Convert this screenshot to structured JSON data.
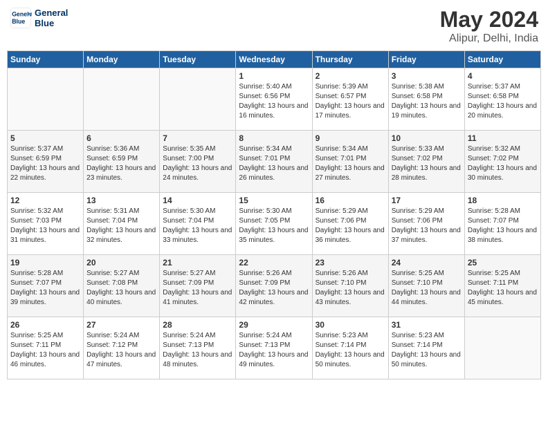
{
  "title": "May 2024",
  "subtitle": "Alipur, Delhi, India",
  "logo": {
    "line1": "General",
    "line2": "Blue"
  },
  "days_of_week": [
    "Sunday",
    "Monday",
    "Tuesday",
    "Wednesday",
    "Thursday",
    "Friday",
    "Saturday"
  ],
  "weeks": [
    [
      {
        "num": "",
        "info": ""
      },
      {
        "num": "",
        "info": ""
      },
      {
        "num": "",
        "info": ""
      },
      {
        "num": "1",
        "info": "Sunrise: 5:40 AM\nSunset: 6:56 PM\nDaylight: 13 hours and 16 minutes."
      },
      {
        "num": "2",
        "info": "Sunrise: 5:39 AM\nSunset: 6:57 PM\nDaylight: 13 hours and 17 minutes."
      },
      {
        "num": "3",
        "info": "Sunrise: 5:38 AM\nSunset: 6:58 PM\nDaylight: 13 hours and 19 minutes."
      },
      {
        "num": "4",
        "info": "Sunrise: 5:37 AM\nSunset: 6:58 PM\nDaylight: 13 hours and 20 minutes."
      }
    ],
    [
      {
        "num": "5",
        "info": "Sunrise: 5:37 AM\nSunset: 6:59 PM\nDaylight: 13 hours and 22 minutes."
      },
      {
        "num": "6",
        "info": "Sunrise: 5:36 AM\nSunset: 6:59 PM\nDaylight: 13 hours and 23 minutes."
      },
      {
        "num": "7",
        "info": "Sunrise: 5:35 AM\nSunset: 7:00 PM\nDaylight: 13 hours and 24 minutes."
      },
      {
        "num": "8",
        "info": "Sunrise: 5:34 AM\nSunset: 7:01 PM\nDaylight: 13 hours and 26 minutes."
      },
      {
        "num": "9",
        "info": "Sunrise: 5:34 AM\nSunset: 7:01 PM\nDaylight: 13 hours and 27 minutes."
      },
      {
        "num": "10",
        "info": "Sunrise: 5:33 AM\nSunset: 7:02 PM\nDaylight: 13 hours and 28 minutes."
      },
      {
        "num": "11",
        "info": "Sunrise: 5:32 AM\nSunset: 7:02 PM\nDaylight: 13 hours and 30 minutes."
      }
    ],
    [
      {
        "num": "12",
        "info": "Sunrise: 5:32 AM\nSunset: 7:03 PM\nDaylight: 13 hours and 31 minutes."
      },
      {
        "num": "13",
        "info": "Sunrise: 5:31 AM\nSunset: 7:04 PM\nDaylight: 13 hours and 32 minutes."
      },
      {
        "num": "14",
        "info": "Sunrise: 5:30 AM\nSunset: 7:04 PM\nDaylight: 13 hours and 33 minutes."
      },
      {
        "num": "15",
        "info": "Sunrise: 5:30 AM\nSunset: 7:05 PM\nDaylight: 13 hours and 35 minutes."
      },
      {
        "num": "16",
        "info": "Sunrise: 5:29 AM\nSunset: 7:06 PM\nDaylight: 13 hours and 36 minutes."
      },
      {
        "num": "17",
        "info": "Sunrise: 5:29 AM\nSunset: 7:06 PM\nDaylight: 13 hours and 37 minutes."
      },
      {
        "num": "18",
        "info": "Sunrise: 5:28 AM\nSunset: 7:07 PM\nDaylight: 13 hours and 38 minutes."
      }
    ],
    [
      {
        "num": "19",
        "info": "Sunrise: 5:28 AM\nSunset: 7:07 PM\nDaylight: 13 hours and 39 minutes."
      },
      {
        "num": "20",
        "info": "Sunrise: 5:27 AM\nSunset: 7:08 PM\nDaylight: 13 hours and 40 minutes."
      },
      {
        "num": "21",
        "info": "Sunrise: 5:27 AM\nSunset: 7:09 PM\nDaylight: 13 hours and 41 minutes."
      },
      {
        "num": "22",
        "info": "Sunrise: 5:26 AM\nSunset: 7:09 PM\nDaylight: 13 hours and 42 minutes."
      },
      {
        "num": "23",
        "info": "Sunrise: 5:26 AM\nSunset: 7:10 PM\nDaylight: 13 hours and 43 minutes."
      },
      {
        "num": "24",
        "info": "Sunrise: 5:25 AM\nSunset: 7:10 PM\nDaylight: 13 hours and 44 minutes."
      },
      {
        "num": "25",
        "info": "Sunrise: 5:25 AM\nSunset: 7:11 PM\nDaylight: 13 hours and 45 minutes."
      }
    ],
    [
      {
        "num": "26",
        "info": "Sunrise: 5:25 AM\nSunset: 7:11 PM\nDaylight: 13 hours and 46 minutes."
      },
      {
        "num": "27",
        "info": "Sunrise: 5:24 AM\nSunset: 7:12 PM\nDaylight: 13 hours and 47 minutes."
      },
      {
        "num": "28",
        "info": "Sunrise: 5:24 AM\nSunset: 7:13 PM\nDaylight: 13 hours and 48 minutes."
      },
      {
        "num": "29",
        "info": "Sunrise: 5:24 AM\nSunset: 7:13 PM\nDaylight: 13 hours and 49 minutes."
      },
      {
        "num": "30",
        "info": "Sunrise: 5:23 AM\nSunset: 7:14 PM\nDaylight: 13 hours and 50 minutes."
      },
      {
        "num": "31",
        "info": "Sunrise: 5:23 AM\nSunset: 7:14 PM\nDaylight: 13 hours and 50 minutes."
      },
      {
        "num": "",
        "info": ""
      }
    ]
  ]
}
